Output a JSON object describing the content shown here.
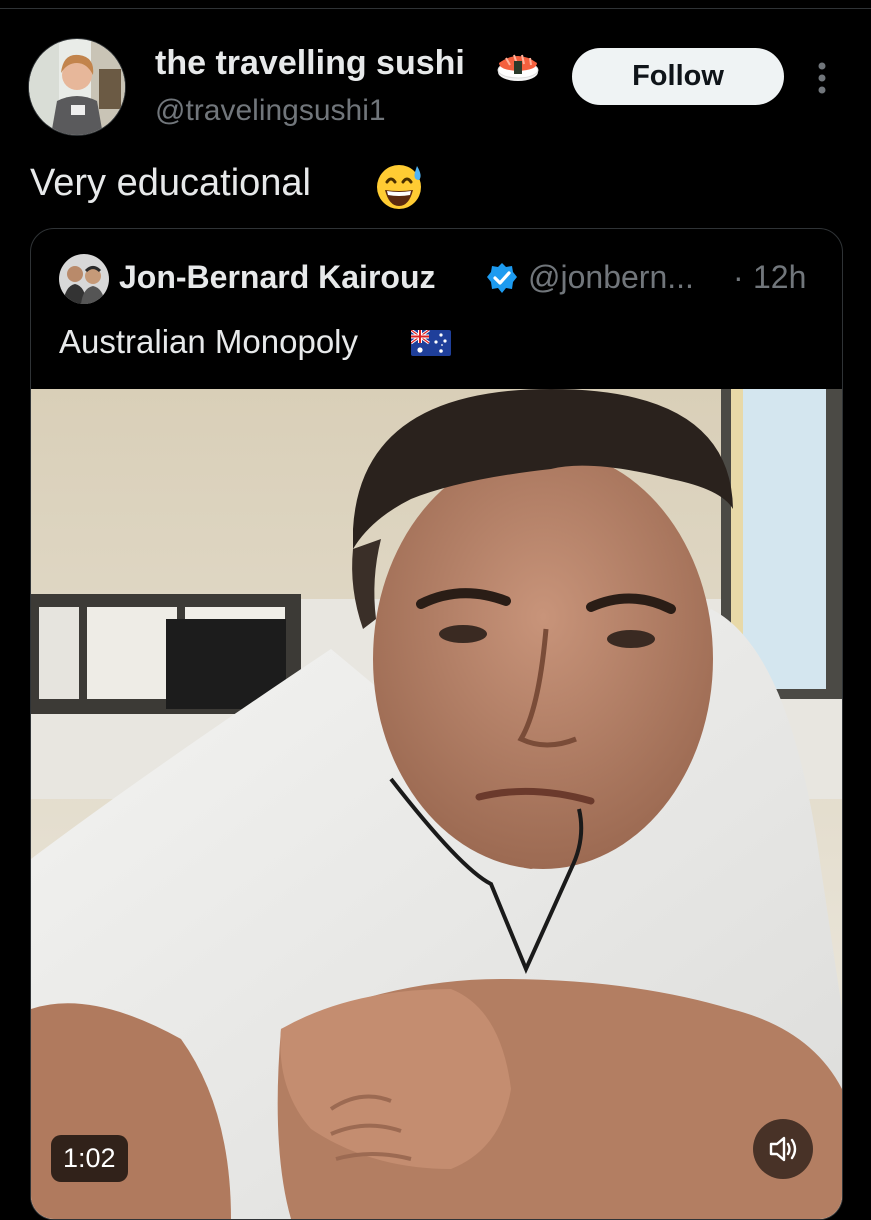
{
  "tweet": {
    "author": {
      "display_name": "the travelling sushi",
      "name_emoji": "sushi-icon",
      "handle": "@travelingsushi1"
    },
    "follow_label": "Follow",
    "more_icon": "more-dots-icon",
    "text": "Very educational",
    "text_emoji": "grinning-sweat-emoji"
  },
  "quote": {
    "author": {
      "display_name": "Jon-Bernard Kairouz",
      "verified_icon": "verified-badge-icon",
      "handle": "@jonbern...",
      "separator": "·",
      "time": "12h"
    },
    "text": "Australian Monopoly",
    "text_emoji": "australia-flag-icon",
    "media": {
      "type": "video",
      "duration": "1:02",
      "volume_icon": "volume-icon"
    }
  },
  "colors": {
    "background": "#000000",
    "primary_text": "#e7e9ea",
    "secondary_text": "#71767b",
    "border": "#2f3336",
    "verified": "#1d9bf0",
    "follow_button_bg": "#eff3f4"
  }
}
